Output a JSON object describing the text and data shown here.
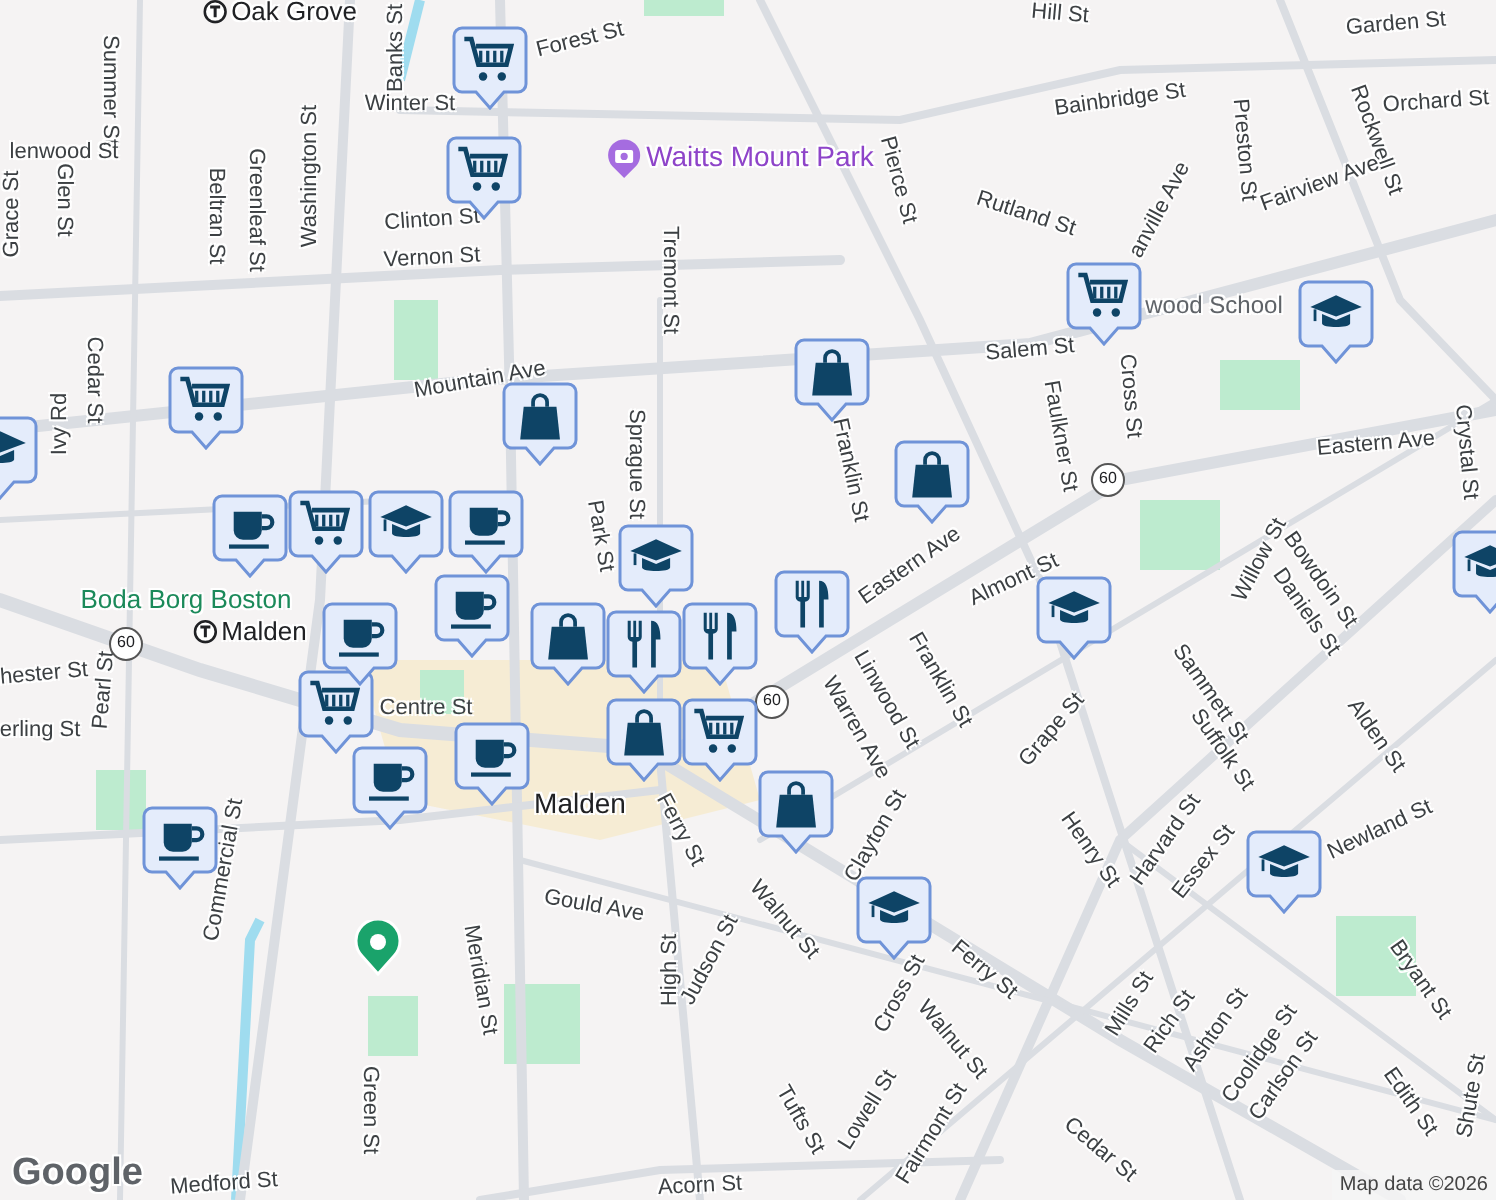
{
  "labels": [
    {
      "text": "Oak Grove",
      "kind": "transit"
    },
    {
      "text": "Banks St",
      "kind": "street"
    },
    {
      "text": "Forest St",
      "kind": "street"
    },
    {
      "text": "Winter St",
      "kind": "street"
    },
    {
      "text": "Summer St",
      "kind": "street"
    },
    {
      "text": "lenwood St",
      "kind": "street"
    },
    {
      "text": "Glen St",
      "kind": "street"
    },
    {
      "text": "Grace St",
      "kind": "street"
    },
    {
      "text": "Beltran St",
      "kind": "street"
    },
    {
      "text": "Greenleaf St",
      "kind": "street"
    },
    {
      "text": "Washington St",
      "kind": "street"
    },
    {
      "text": "Clinton St",
      "kind": "street"
    },
    {
      "text": "Vernon St",
      "kind": "street"
    },
    {
      "text": "Waitts Mount Park",
      "kind": "park"
    },
    {
      "text": "Tremont St",
      "kind": "street"
    },
    {
      "text": "Hill St",
      "kind": "street"
    },
    {
      "text": "Garden St",
      "kind": "street"
    },
    {
      "text": "Bainbridge St",
      "kind": "street"
    },
    {
      "text": "Orchard St",
      "kind": "street"
    },
    {
      "text": "Rockwell St",
      "kind": "street"
    },
    {
      "text": "Preston St",
      "kind": "street"
    },
    {
      "text": "Fairview Ave",
      "kind": "street"
    },
    {
      "text": "Pierce St",
      "kind": "street"
    },
    {
      "text": "Rutland St",
      "kind": "street"
    },
    {
      "text": "anville Ave",
      "kind": "street"
    },
    {
      "text": "wood School",
      "kind": "place"
    },
    {
      "text": "Salem St",
      "kind": "street"
    },
    {
      "text": "Mountain Ave",
      "kind": "street"
    },
    {
      "text": "Cross St",
      "kind": "street"
    },
    {
      "text": "Faulkner St",
      "kind": "street"
    },
    {
      "text": "Eastern Ave",
      "kind": "street"
    },
    {
      "text": "Franklin St",
      "kind": "street"
    },
    {
      "text": "Eastern Ave",
      "kind": "street"
    },
    {
      "text": "Almont St",
      "kind": "street"
    },
    {
      "text": "Willow St",
      "kind": "street"
    },
    {
      "text": "Bowdoin St",
      "kind": "street"
    },
    {
      "text": "Daniels St",
      "kind": "street"
    },
    {
      "text": "Crystal St",
      "kind": "street"
    },
    {
      "text": "Franklin St",
      "kind": "street"
    },
    {
      "text": "Linwood St",
      "kind": "street"
    },
    {
      "text": "Warren Ave",
      "kind": "street"
    },
    {
      "text": "Grape St",
      "kind": "street"
    },
    {
      "text": "Sammett St",
      "kind": "street"
    },
    {
      "text": "Suffolk St",
      "kind": "street"
    },
    {
      "text": "Alden St",
      "kind": "street"
    },
    {
      "text": "Sprague St",
      "kind": "street"
    },
    {
      "text": "Park St",
      "kind": "street"
    },
    {
      "text": "Boda Borg Boston",
      "kind": "attraction"
    },
    {
      "text": "Malden",
      "kind": "transit"
    },
    {
      "text": "hester St",
      "kind": "street"
    },
    {
      "text": "erling St",
      "kind": "street"
    },
    {
      "text": "Pearl St",
      "kind": "street"
    },
    {
      "text": "Centre St",
      "kind": "street"
    },
    {
      "text": "Commercial St",
      "kind": "street"
    },
    {
      "text": "Cedar St",
      "kind": "street"
    },
    {
      "text": "Ivy Rd",
      "kind": "street"
    },
    {
      "text": "Malden",
      "kind": "area"
    },
    {
      "text": "Ferry St",
      "kind": "street"
    },
    {
      "text": "Clayton St",
      "kind": "street"
    },
    {
      "text": "Gould Ave",
      "kind": "street"
    },
    {
      "text": "High St",
      "kind": "street"
    },
    {
      "text": "Judson St",
      "kind": "street"
    },
    {
      "text": "Walnut St",
      "kind": "street"
    },
    {
      "text": "Cross St",
      "kind": "street"
    },
    {
      "text": "Ferry St",
      "kind": "street"
    },
    {
      "text": "Meridian St",
      "kind": "street"
    },
    {
      "text": "Green St",
      "kind": "street"
    },
    {
      "text": "Medford St",
      "kind": "street"
    },
    {
      "text": "Acorn St",
      "kind": "street"
    },
    {
      "text": "Walnut St",
      "kind": "street"
    },
    {
      "text": "Lowell St",
      "kind": "street"
    },
    {
      "text": "Tufts St",
      "kind": "street"
    },
    {
      "text": "Fairmont St",
      "kind": "street"
    },
    {
      "text": "Cedar St",
      "kind": "street"
    },
    {
      "text": "Henry St",
      "kind": "street"
    },
    {
      "text": "Harvard St",
      "kind": "street"
    },
    {
      "text": "Essex St",
      "kind": "street"
    },
    {
      "text": "Mills St",
      "kind": "street"
    },
    {
      "text": "Rich St",
      "kind": "street"
    },
    {
      "text": "Ashton St",
      "kind": "street"
    },
    {
      "text": "Coolidge St",
      "kind": "street"
    },
    {
      "text": "Carlson St",
      "kind": "street"
    },
    {
      "text": "Bryant St",
      "kind": "street"
    },
    {
      "text": "Edith St",
      "kind": "street"
    },
    {
      "text": "Shute St",
      "kind": "street"
    },
    {
      "text": "Newland St",
      "kind": "street"
    },
    {
      "text": "60",
      "kind": "shield"
    },
    {
      "text": "60",
      "kind": "shield"
    },
    {
      "text": "60",
      "kind": "shield"
    }
  ],
  "pins": [
    {
      "kind": "cart"
    },
    {
      "kind": "cart"
    },
    {
      "kind": "cart"
    },
    {
      "kind": "cart"
    },
    {
      "kind": "cart"
    },
    {
      "kind": "cart"
    },
    {
      "kind": "cart"
    },
    {
      "kind": "cap"
    },
    {
      "kind": "cap"
    },
    {
      "kind": "cap"
    },
    {
      "kind": "cap"
    },
    {
      "kind": "cap"
    },
    {
      "kind": "cap"
    },
    {
      "kind": "cap"
    },
    {
      "kind": "cap"
    },
    {
      "kind": "cup"
    },
    {
      "kind": "cup"
    },
    {
      "kind": "cup"
    },
    {
      "kind": "cup"
    },
    {
      "kind": "cup"
    },
    {
      "kind": "cup"
    },
    {
      "kind": "cup"
    },
    {
      "kind": "bag"
    },
    {
      "kind": "bag"
    },
    {
      "kind": "bag"
    },
    {
      "kind": "bag"
    },
    {
      "kind": "bag"
    },
    {
      "kind": "bag"
    },
    {
      "kind": "fork"
    },
    {
      "kind": "fork"
    },
    {
      "kind": "fork"
    },
    {
      "kind": "place"
    }
  ],
  "logo": "Google",
  "attribution": "Map data ©2026"
}
